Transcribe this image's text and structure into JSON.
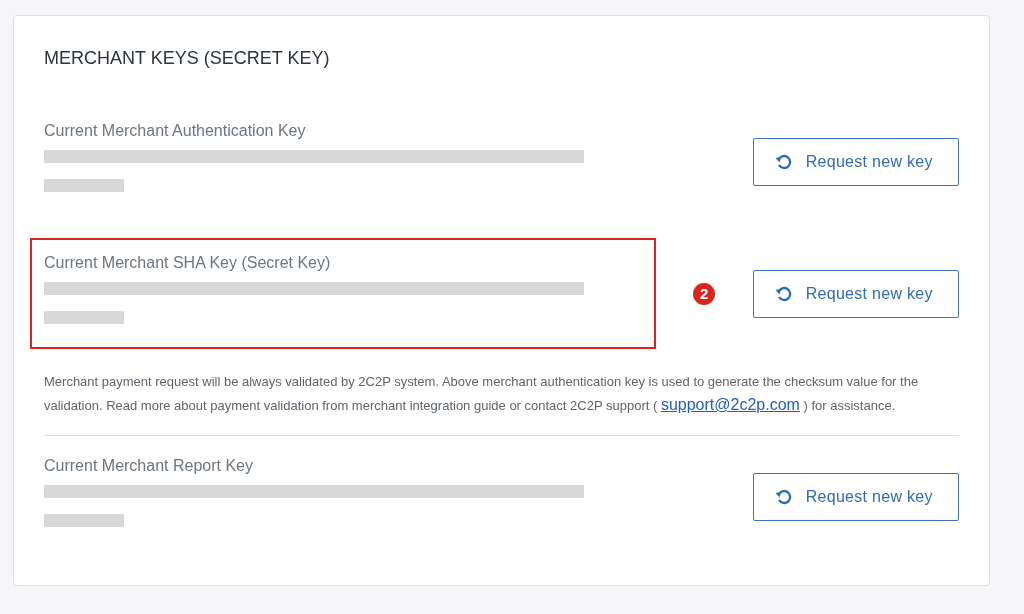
{
  "card": {
    "title": "MERCHANT KEYS (SECRET KEY)"
  },
  "keys": [
    {
      "label": "Current Merchant Authentication Key",
      "highlighted": false,
      "button": "Request new key"
    },
    {
      "label": "Current Merchant SHA Key (Secret Key)",
      "highlighted": true,
      "badge": "2",
      "button": "Request new key"
    },
    {
      "note": {
        "before": "Merchant payment request will be always validated by 2C2P system. Above merchant authentication key is used to generate the checksum value for the validation. Read more about payment validation from merchant integration guide or contact 2C2P support (",
        "link": "support@2c2p.com",
        "after": ") for assistance."
      }
    },
    {
      "label": "Current Merchant Report Key",
      "highlighted": false,
      "button": "Request new key"
    }
  ]
}
